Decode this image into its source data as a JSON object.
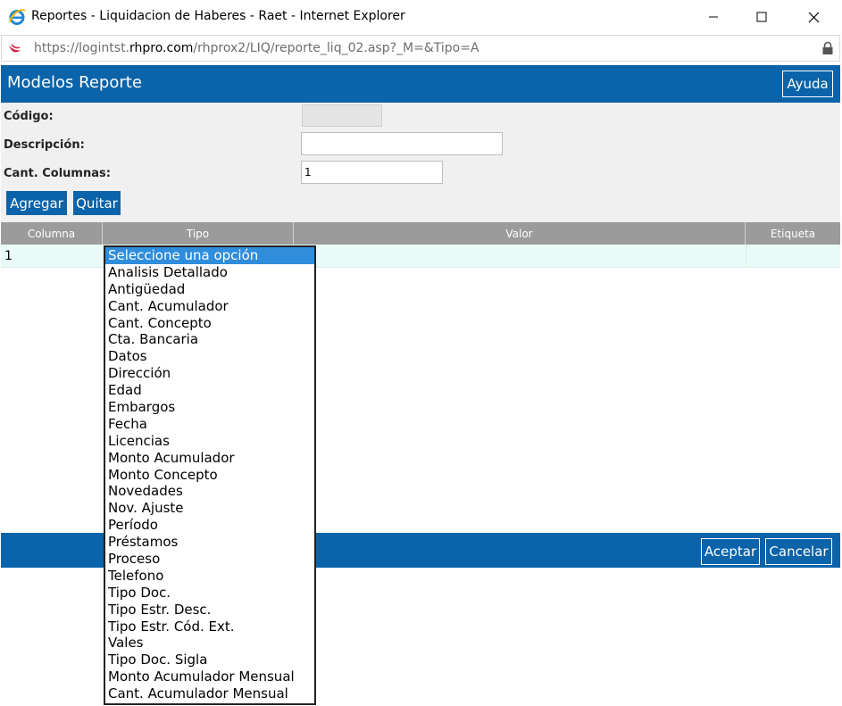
{
  "window": {
    "title": "Reportes - Liquidacion de Haberes - Raet - Internet Explorer"
  },
  "address": {
    "url_prefix": "https://logintst.",
    "url_host": "rhpro.com",
    "url_path": "/rhprox2/LIQ/reporte_liq_02.asp?_M=&Tipo=A"
  },
  "header": {
    "title": "Modelos Reporte",
    "help_label": "Ayuda"
  },
  "form": {
    "codigo_label": "Código:",
    "codigo_value": "",
    "descripcion_label": "Descripción:",
    "descripcion_value": "",
    "cant_columnas_label": "Cant. Columnas:",
    "cant_columnas_value": "1",
    "add_label": "Agregar",
    "remove_label": "Quitar"
  },
  "table": {
    "columns": [
      "Columna",
      "Tipo",
      "Valor",
      "Etiqueta"
    ],
    "rows": [
      {
        "columna": "1",
        "tipo": "Seleccione una opción",
        "valor": "",
        "etiqueta": ""
      }
    ]
  },
  "tipo_dropdown": {
    "selected_index": 0,
    "options": [
      "Seleccione una opción",
      "Analisis Detallado",
      "Antigüedad",
      "Cant. Acumulador",
      "Cant. Concepto",
      "Cta. Bancaria",
      "Datos",
      "Dirección",
      "Edad",
      "Embargos",
      "Fecha",
      "Licencias",
      "Monto Acumulador",
      "Monto Concepto",
      "Novedades",
      "Nov. Ajuste",
      "Período",
      "Préstamos",
      "Proceso",
      "Telefono",
      "Tipo Doc.",
      "Tipo Estr. Desc.",
      "Tipo Estr. Cód. Ext.",
      "Vales",
      "Tipo Doc. Sigla",
      "Monto Acumulador Mensual",
      "Cant. Acumulador Mensual"
    ]
  },
  "footer": {
    "accept_label": "Aceptar",
    "cancel_label": "Cancelar"
  },
  "colors": {
    "brand_blue": "#0b63a9",
    "selected_option": "#2f8ddb",
    "table_header": "#9b9b9b",
    "row_background": "#e9fbf8"
  }
}
